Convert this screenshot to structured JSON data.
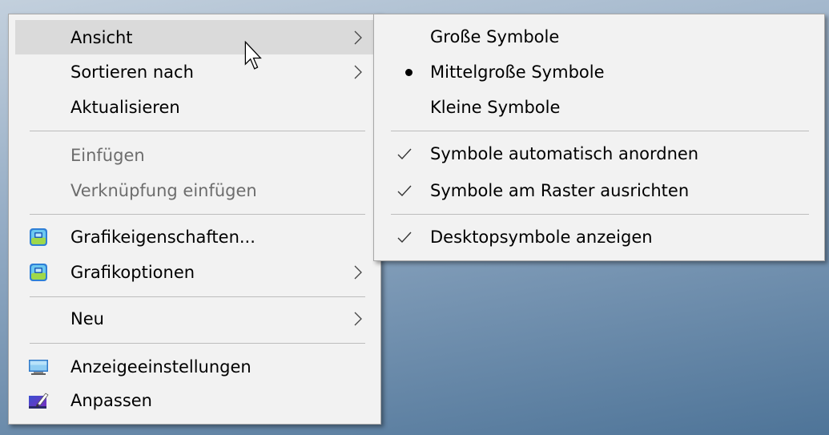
{
  "desktop": {
    "gradient_top": "#c3d0dd",
    "gradient_mid": "#93abc4",
    "gradient_bottom": "#4e7498"
  },
  "colors": {
    "menu_background": "#f2f2f2",
    "highlight": "#dadada",
    "text": "#000000",
    "disabled_text": "#6d6d6d",
    "separator": "#bdbdbd",
    "border": "#a8a8a8"
  },
  "context_menu": {
    "items": [
      {
        "label": "Ansicht",
        "has_submenu": true,
        "highlighted": true,
        "enabled": true
      },
      {
        "label": "Sortieren nach",
        "has_submenu": true,
        "enabled": true
      },
      {
        "label": "Aktualisieren",
        "enabled": true
      },
      {
        "label": "Einfügen",
        "enabled": false
      },
      {
        "label": "Verknüpfung einfügen",
        "enabled": false
      },
      {
        "label": "Grafikeigenschaften...",
        "icon": "intel-graphics-icon",
        "enabled": true
      },
      {
        "label": "Grafikoptionen",
        "icon": "intel-graphics-icon",
        "has_submenu": true,
        "enabled": true
      },
      {
        "label": "Neu",
        "has_submenu": true,
        "enabled": true
      },
      {
        "label": "Anzeigeeinstellungen",
        "icon": "display-settings-icon",
        "enabled": true
      },
      {
        "label": "Anpassen",
        "icon": "personalize-icon",
        "enabled": true
      }
    ]
  },
  "view_submenu": {
    "items": [
      {
        "label": "Große Symbole",
        "selected": false
      },
      {
        "label": "Mittelgroße Symbole",
        "selected": true
      },
      {
        "label": "Kleine Symbole",
        "selected": false
      },
      {
        "label": "Symbole automatisch anordnen",
        "checked": true
      },
      {
        "label": "Symbole am Raster ausrichten",
        "checked": true
      },
      {
        "label": "Desktopsymbole anzeigen",
        "checked": true
      }
    ]
  }
}
